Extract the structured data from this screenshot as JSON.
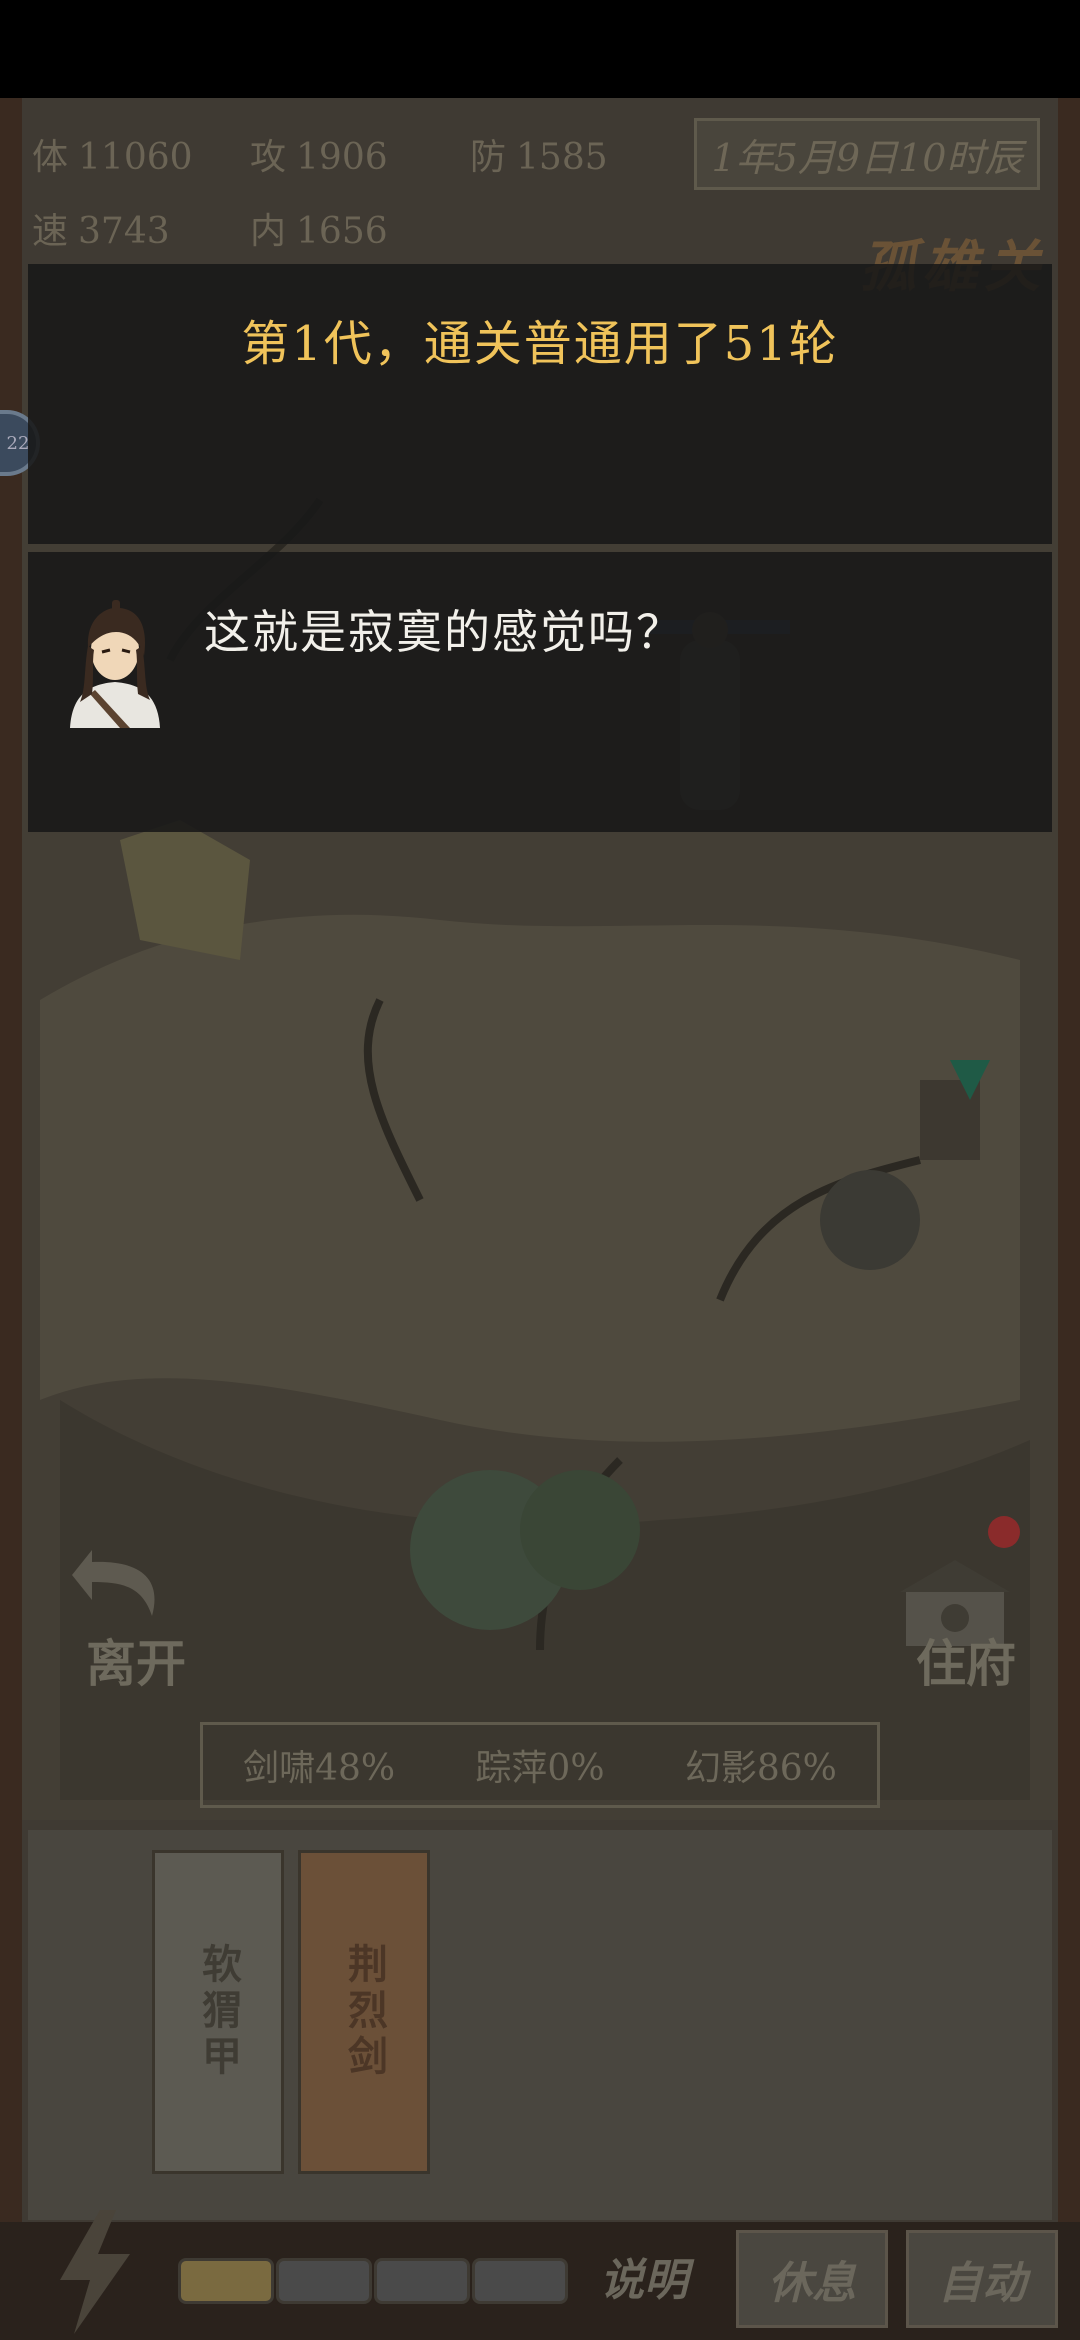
{
  "stats": {
    "hp": {
      "key": "体",
      "value": "11060"
    },
    "atk": {
      "key": "攻",
      "value": "1906"
    },
    "def": {
      "key": "防",
      "value": "1585"
    },
    "spd": {
      "key": "速",
      "value": "3743"
    },
    "inner": {
      "key": "内",
      "value": "1656"
    }
  },
  "date": "1年5月9日10时辰",
  "location": "孤雄关",
  "banner": {
    "text": "第1代，通关普通用了51轮"
  },
  "dialog": {
    "text": "这就是寂寞的感觉吗？"
  },
  "side_badge": "22",
  "nav": {
    "leave": "离开",
    "residence": "住府"
  },
  "skills": [
    {
      "label": "剑啸48%"
    },
    {
      "label": "踪萍0%"
    },
    {
      "label": "幻影86%"
    }
  ],
  "equipment": [
    {
      "label": "软猬甲"
    },
    {
      "label": "荆烈剑"
    }
  ],
  "footer": {
    "explain": "说明",
    "rest": "休息",
    "auto": "自动",
    "energy_filled": 1,
    "energy_total": 4
  },
  "colors": {
    "banner_text": "#f0c35a",
    "dialog_text": "#f2f0ea",
    "overlay": "#181818"
  }
}
